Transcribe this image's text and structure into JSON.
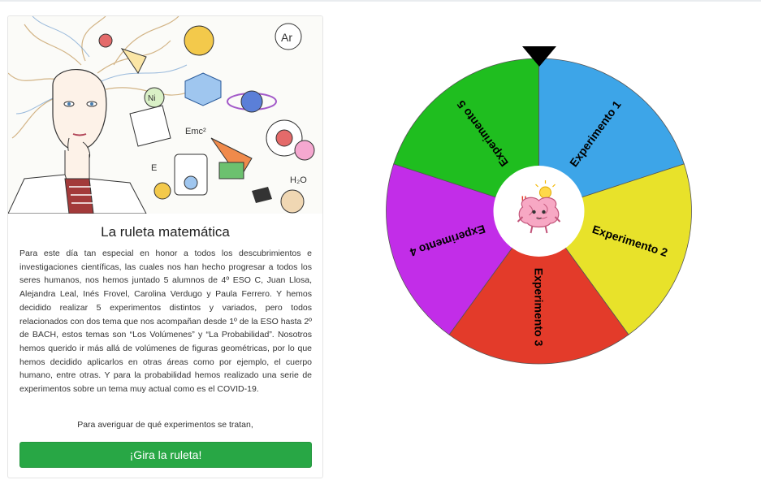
{
  "card": {
    "title": "La ruleta matemática",
    "paragraph": "Para este día tan especial en honor a todos los descubrimientos e investigaciones científicas, las cuales nos han hecho progresar a todos los seres humanos, nos hemos juntado 5 alumnos de 4º ESO C, Juan Llosa, Alejandra Leal, Inés Frovel, Carolina Verdugo y Paula Ferrero. Y hemos decidido realizar 5 experimentos distintos y variados, pero todos relacionados con dos tema que nos acompañan desde 1º de la ESO hasta 2º de BACH, estos temas son “Los Volúmenes” y “La Probabilidad”. Nosotros hemos querido ir más allá de volúmenes de figuras geométricas, por lo que hemos decidido aplicarlos en otras áreas como por ejemplo, el cuerpo humano, entre otras. Y para la probabilidad hemos realizado una serie de experimentos sobre un tema muy actual como es el COVID-19.",
    "prompt": "Para averiguar de qué experimentos se tratan,",
    "button_label": "¡Gira la ruleta!",
    "image_lettering": [
      "Ar",
      "Ni",
      "Emc²",
      "H₂O",
      "E"
    ]
  },
  "wheel": {
    "center_icon": "brain-lightbulb-icon",
    "pointer_icon": "triangle-pointer-icon",
    "segments": [
      {
        "label": "Experimento 1",
        "color": "#3da5e8"
      },
      {
        "label": "Experimento 2",
        "color": "#e8e22a"
      },
      {
        "label": "Experimento 3",
        "color": "#e33b2a"
      },
      {
        "label": "Experimento 4",
        "color": "#c22de8"
      },
      {
        "label": "Experimento 5",
        "color": "#1fbe1f"
      }
    ]
  }
}
